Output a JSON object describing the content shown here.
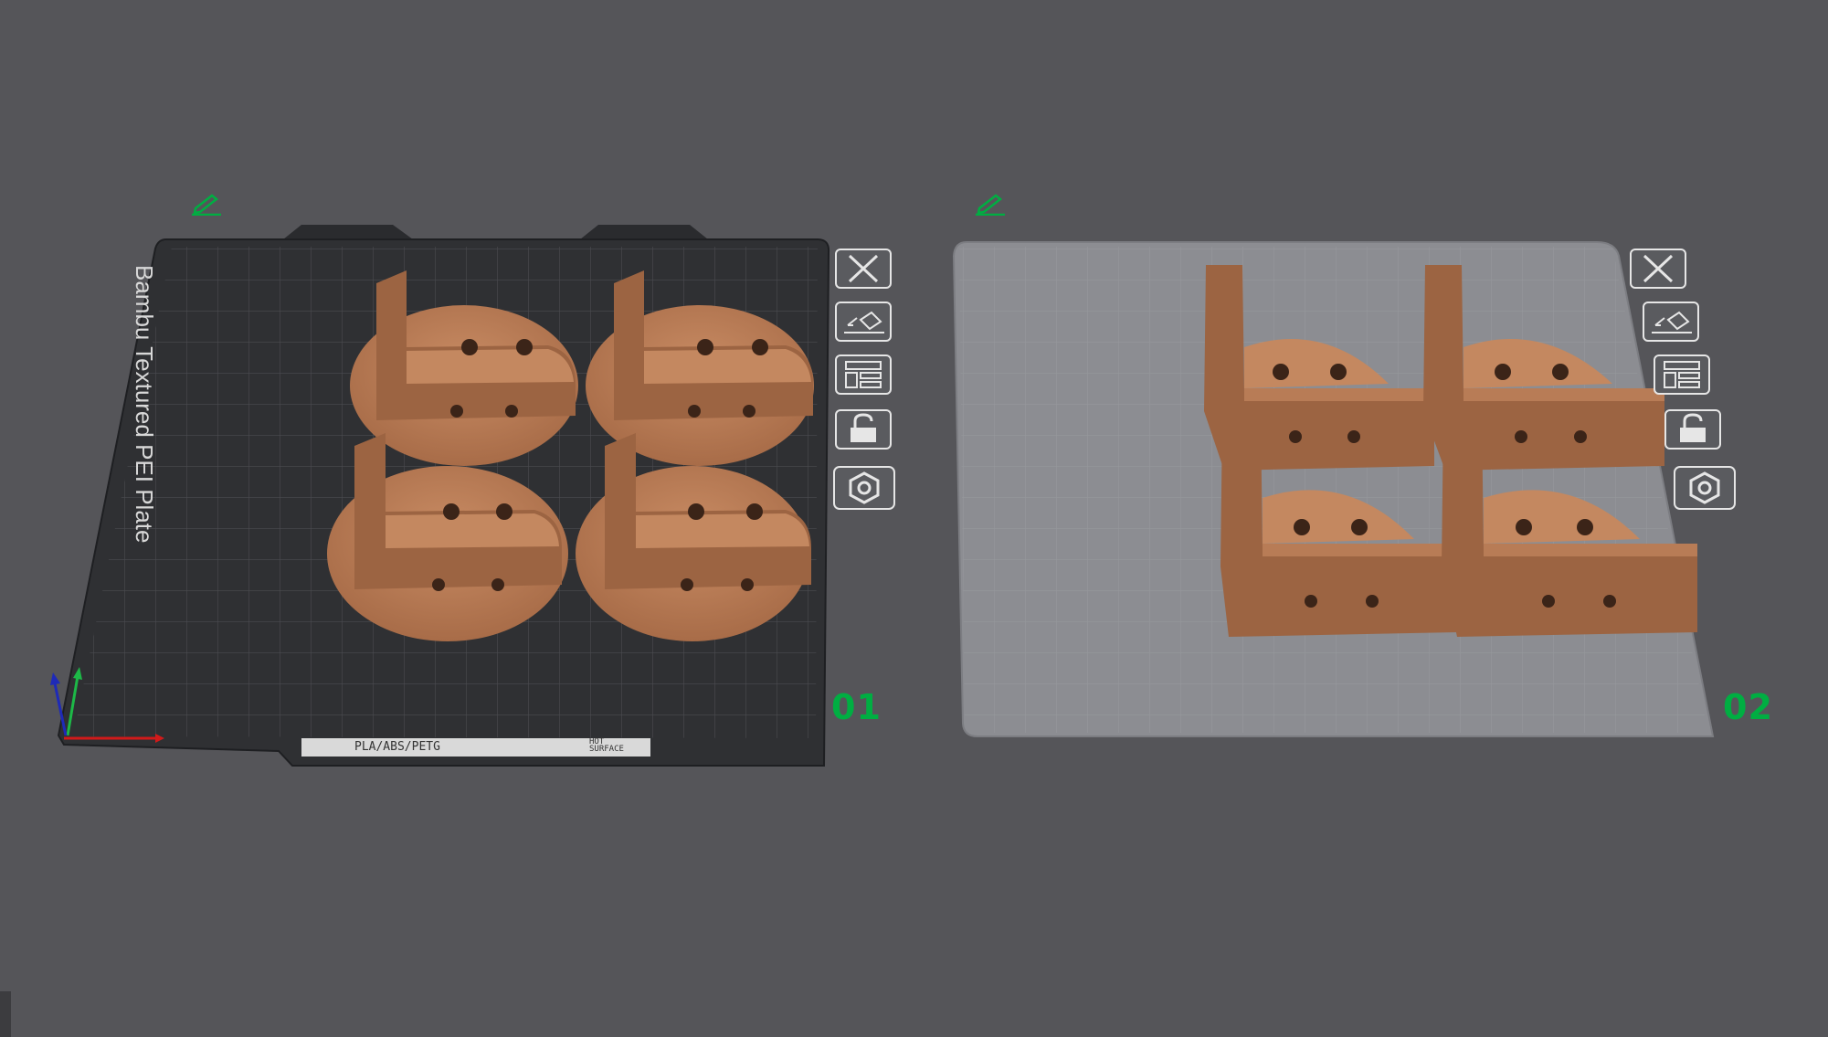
{
  "colors": {
    "background": "#555559",
    "plate_dark": "#2f3033",
    "plate_light": "#8c8d92",
    "model": "#b77a55",
    "plate_number": "#00ae42",
    "edit_icon": "#00ae42"
  },
  "plates": [
    {
      "number": "01",
      "surface_name": "Bambu Textured PEI Plate",
      "strip_material": "PLA/ABS/PETG",
      "strip_warning": "HOT\nSURFACE",
      "edit_icon": "pencil-icon",
      "buttons": [
        "close-icon",
        "auto-orient-icon",
        "arrange-icon",
        "lock-icon",
        "settings-icon"
      ]
    },
    {
      "number": "02",
      "edit_icon": "pencil-icon",
      "buttons": [
        "close-icon",
        "auto-orient-icon",
        "arrange-icon",
        "lock-icon",
        "settings-icon"
      ]
    }
  ]
}
